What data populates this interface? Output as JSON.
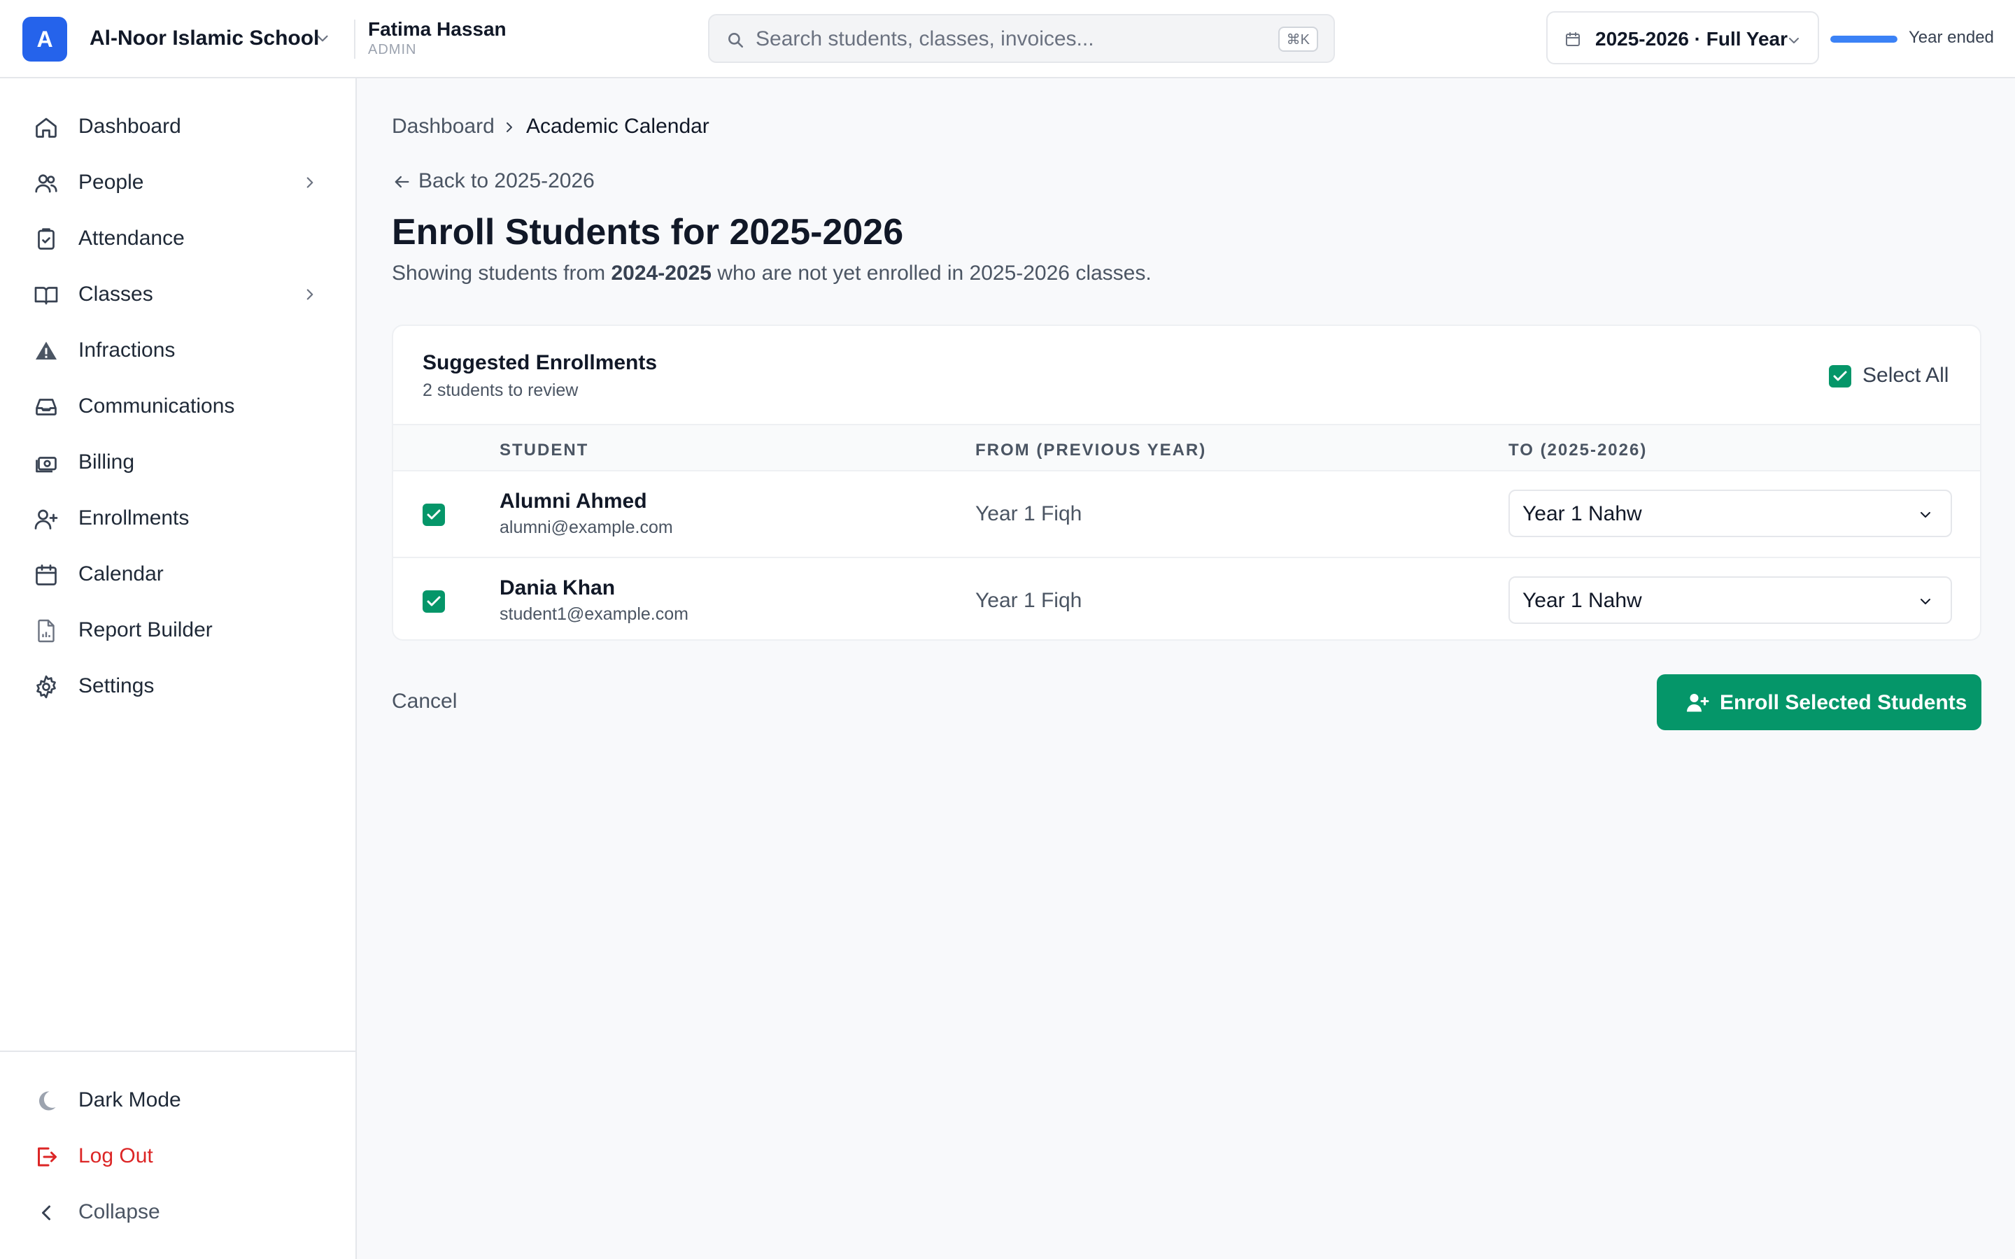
{
  "topbar": {
    "logo_letter": "A",
    "school_name": "Al-Noor Islamic School",
    "user_name": "Fatima Hassan",
    "user_role": "ADMIN",
    "search_placeholder": "Search students, classes, invoices...",
    "search_shortcut": "⌘K",
    "year_label": "2025-2026 · Full Year",
    "year_progress_fraction": 1.0,
    "year_status": "Year ended"
  },
  "sidebar": {
    "items": [
      {
        "label": "Dashboard",
        "icon": "home-icon"
      },
      {
        "label": "People",
        "icon": "users-icon"
      },
      {
        "label": "Attendance",
        "icon": "clipboard-check-icon"
      },
      {
        "label": "Classes",
        "icon": "book-open-icon"
      },
      {
        "label": "Infractions",
        "icon": "warning-icon"
      },
      {
        "label": "Communications",
        "icon": "inbox-icon"
      },
      {
        "label": "Billing",
        "icon": "cash-icon"
      },
      {
        "label": "Enrollments",
        "icon": "user-plus-icon"
      },
      {
        "label": "Calendar",
        "icon": "calendar-icon"
      },
      {
        "label": "Report Builder",
        "icon": "document-chart-icon"
      },
      {
        "label": "Settings",
        "icon": "gear-icon"
      }
    ],
    "dark_mode": "Dark Mode",
    "log_out": "Log Out",
    "collapse": "Collapse"
  },
  "breadcrumb": {
    "home": "Dashboard",
    "current": "Academic Calendar"
  },
  "back_link": "Back to 2025-2026",
  "page": {
    "title": "Enroll Students for 2025-2026",
    "subtitle_prefix": "Showing students from ",
    "subtitle_year": "2024-2025",
    "subtitle_suffix": " who are not yet enrolled in 2025-2026 classes."
  },
  "card": {
    "title": "Suggested Enrollments",
    "subtitle": "2 students to review",
    "select_all": "Select All",
    "select_all_checked": true,
    "columns": [
      "STUDENT",
      "FROM (PREVIOUS YEAR)",
      "TO (2025-2026)"
    ],
    "rows": [
      {
        "checked": true,
        "name": "Alumni Ahmed",
        "email": "alumni@example.com",
        "from": "Year 1 Fiqh",
        "to": "Year 1 Nahw"
      },
      {
        "checked": true,
        "name": "Dania Khan",
        "email": "student1@example.com",
        "from": "Year 1 Fiqh",
        "to": "Year 1 Nahw"
      }
    ]
  },
  "actions": {
    "cancel": "Cancel",
    "enroll": "Enroll Selected Students"
  },
  "colors": {
    "brand_blue": "#2563eb",
    "accent_green": "#059669",
    "danger_red": "#dc2626"
  }
}
